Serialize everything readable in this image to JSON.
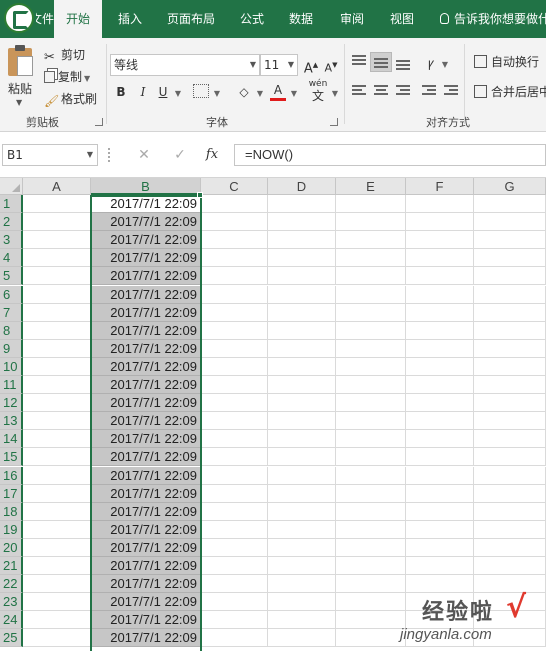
{
  "tabs": [
    {
      "label": "文件",
      "active": false
    },
    {
      "label": "开始",
      "active": true
    },
    {
      "label": "插入",
      "active": false
    },
    {
      "label": "页面布局",
      "active": false
    },
    {
      "label": "公式",
      "active": false
    },
    {
      "label": "数据",
      "active": false
    },
    {
      "label": "审阅",
      "active": false
    },
    {
      "label": "视图",
      "active": false
    }
  ],
  "tell_me": "告诉我你想要做什",
  "clipboard": {
    "paste": "粘贴",
    "cut": "剪切",
    "copy": "复制",
    "format_painter": "格式刷",
    "group_label": "剪贴板"
  },
  "font": {
    "name": "等线",
    "size": "11",
    "grow": "A",
    "shrink": "A",
    "bold": "B",
    "italic": "I",
    "underline": "U",
    "color_a": "A",
    "phonetic": "wén",
    "phonetic_char": "文",
    "group_label": "字体"
  },
  "alignment": {
    "wrap_text": "自动换行",
    "merge_center": "合并后居中",
    "group_label": "对齐方式"
  },
  "formula_bar": {
    "name_box": "B1",
    "cancel": "✕",
    "enter": "✓",
    "fx": "fx",
    "formula": "=NOW()"
  },
  "columns": [
    "A",
    "B",
    "C",
    "D",
    "E",
    "F",
    "G"
  ],
  "rows": [
    {
      "num": "1",
      "b": "2017/7/1 22:09"
    },
    {
      "num": "2",
      "b": "2017/7/1 22:09"
    },
    {
      "num": "3",
      "b": "2017/7/1 22:09"
    },
    {
      "num": "4",
      "b": "2017/7/1 22:09"
    },
    {
      "num": "5",
      "b": "2017/7/1 22:09"
    },
    {
      "num": "6",
      "b": "2017/7/1 22:09"
    },
    {
      "num": "7",
      "b": "2017/7/1 22:09"
    },
    {
      "num": "8",
      "b": "2017/7/1 22:09"
    },
    {
      "num": "9",
      "b": "2017/7/1 22:09"
    },
    {
      "num": "10",
      "b": "2017/7/1 22:09"
    },
    {
      "num": "11",
      "b": "2017/7/1 22:09"
    },
    {
      "num": "12",
      "b": "2017/7/1 22:09"
    },
    {
      "num": "13",
      "b": "2017/7/1 22:09"
    },
    {
      "num": "14",
      "b": "2017/7/1 22:09"
    },
    {
      "num": "15",
      "b": "2017/7/1 22:09"
    },
    {
      "num": "16",
      "b": "2017/7/1 22:09"
    },
    {
      "num": "17",
      "b": "2017/7/1 22:09"
    },
    {
      "num": "18",
      "b": "2017/7/1 22:09"
    },
    {
      "num": "19",
      "b": "2017/7/1 22:09"
    },
    {
      "num": "20",
      "b": "2017/7/1 22:09"
    },
    {
      "num": "21",
      "b": "2017/7/1 22:09"
    },
    {
      "num": "22",
      "b": "2017/7/1 22:09"
    },
    {
      "num": "23",
      "b": "2017/7/1 22:09"
    },
    {
      "num": "24",
      "b": "2017/7/1 22:09"
    },
    {
      "num": "25",
      "b": "2017/7/1 22:09"
    }
  ],
  "watermark": {
    "cn": "经验啦",
    "check": "√",
    "url": "jingyanla.com"
  },
  "colors": {
    "excel_green": "#217346",
    "selection_fill": "#c6c6c6",
    "watermark_check": "#e03a2f"
  }
}
